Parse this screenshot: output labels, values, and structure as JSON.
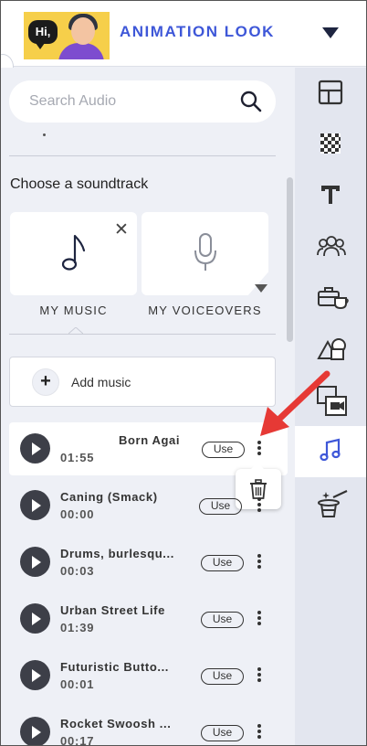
{
  "header": {
    "title": "ANIMATION LOOK",
    "thumbnail_text": "Hi,"
  },
  "search": {
    "placeholder": "Search Audio"
  },
  "soundtrack": {
    "title": "Choose a soundtrack",
    "cards": [
      {
        "label": "MY MUSIC",
        "icon": "music-note-icon"
      },
      {
        "label": "MY VOICEOVERS",
        "icon": "microphone-icon"
      }
    ]
  },
  "add_music": {
    "label": "Add music"
  },
  "tracks": [
    {
      "name": "Born Agai",
      "duration": "01:55",
      "use_label": "Use"
    },
    {
      "name": "Caning (Smack)",
      "duration": "00:00",
      "use_label": "Use"
    },
    {
      "name": "Drums, burlesqu...",
      "duration": "00:03",
      "use_label": "Use"
    },
    {
      "name": "Urban Street Life",
      "duration": "01:39",
      "use_label": "Use"
    },
    {
      "name": "Futuristic Butto...",
      "duration": "00:01",
      "use_label": "Use"
    },
    {
      "name": "Rocket Swoosh ...",
      "duration": "00:17",
      "use_label": "Use"
    }
  ],
  "rail": {
    "items": [
      {
        "icon": "layout-icon"
      },
      {
        "icon": "background-pattern-icon"
      },
      {
        "icon": "text-icon"
      },
      {
        "icon": "characters-icon"
      },
      {
        "icon": "props-icon"
      },
      {
        "icon": "shapes-icon"
      },
      {
        "icon": "media-icon"
      },
      {
        "icon": "music-icon",
        "active": true
      },
      {
        "icon": "magic-hat-icon"
      }
    ]
  },
  "colors": {
    "accent": "#3e57d8",
    "panel_bg": "#eef0f6",
    "rail_bg": "#e3e6ef",
    "annotation": "#e63935"
  }
}
